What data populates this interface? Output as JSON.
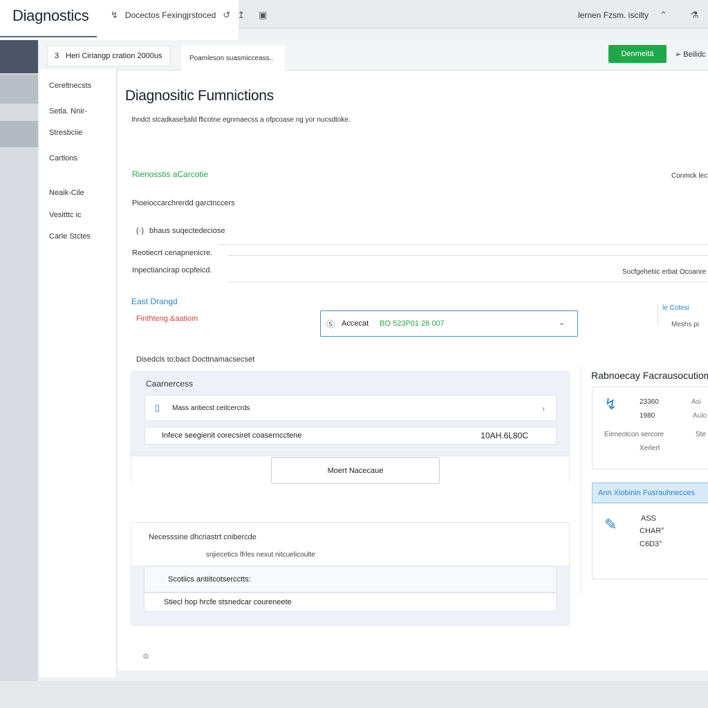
{
  "app": {
    "title": "Diagnostics",
    "breadcrumb": "Docectos Fexingjrstoced",
    "top_right_label": "lernen Fzsm. iscilty"
  },
  "tabs": {
    "tab1_icon": "3",
    "tab1_label": "Heri Ciriangp cration 2000us",
    "tab2_label": "Poamleson suasmicceass..",
    "primary_button": "Denmeitä",
    "next_label": "Beilidc"
  },
  "sidebar": {
    "items": [
      {
        "label": "Cereltnecsts"
      },
      {
        "label": "Setla. Nnir-"
      },
      {
        "label": "Stresbciie"
      },
      {
        "label": "Cartlons"
      },
      {
        "label": "Neaik-Cile"
      },
      {
        "label": "Vesitttc ic"
      },
      {
        "label": "Carle Stctes"
      }
    ]
  },
  "main": {
    "title": "Diagnositic Fumnictions",
    "subtitle": "Ihndct stcadkase§afd fficotne egnmaecss a ofpcoase ng yor nucsdtoke.",
    "section_green": "Rienosstis aCarcotie",
    "right_link1": "Conmck lec",
    "label_a": "Pioeioccarchrerdd garctnccers",
    "item_icon": "(·)",
    "item_label": "bhaus suqectedeciose",
    "label_b": "Reotiecrt cenapnenicre.",
    "label_c": "Inpectiancirap ocpfeicd.",
    "right_link2": "Socfgehetiic erbat Ocoanre",
    "section_blue": "East Drangd",
    "section_red": "Finthteng &aatiom",
    "select_label": "Accecat",
    "select_value": "BO 523P01 26 007",
    "right_blue": "le Cotesi",
    "right_grey": "Meshs pi",
    "label_d": "Disedcls to;bact Docttnamacsecset"
  },
  "card1": {
    "title": "Caarnercess",
    "row1_label": "Mass aritiecst ceitcercrds",
    "row2_label": "Infece seegienit corecsiret coaserncctene",
    "row2_value": "10AH.6L80C",
    "more_button": "Moert Nacecaue"
  },
  "card2": {
    "title": "Necesssine dhcriastrt cnibercde",
    "subtitle": "snjiecetics lfrles nexut nitcuelicoulte",
    "row1": "Scotiics antiitcotsercctts:",
    "row2": "Stiecl hop hrcfe stsnedcar coureneete"
  },
  "right_panel": {
    "title": "Rabnoecay Facrausocutiom",
    "card1": {
      "t1": "23360",
      "t2": "1980",
      "t3": "Asi",
      "t4": "Aulo",
      "t5": "Eieneotcon sercore",
      "t6": "Ste",
      "t7": "Xerlert"
    },
    "card2": {
      "header": "Ann Xiobinin Fusrauhnecces",
      "t1": "ASS",
      "t2": "CHAR°",
      "t3": "C6D3°"
    }
  },
  "icons": {
    "accent": "#2d82c8",
    "success": "#1fa84a",
    "danger": "#d2443d"
  }
}
